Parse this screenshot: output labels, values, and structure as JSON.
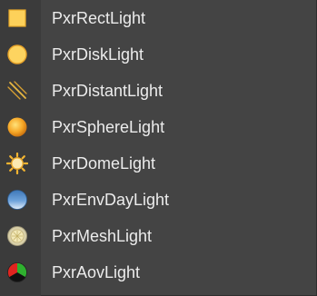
{
  "menu": {
    "items": [
      {
        "label": "PxrRectLight",
        "icon": "rect-light-icon"
      },
      {
        "label": "PxrDiskLight",
        "icon": "disk-light-icon"
      },
      {
        "label": "PxrDistantLight",
        "icon": "distant-light-icon"
      },
      {
        "label": "PxrSphereLight",
        "icon": "sphere-light-icon"
      },
      {
        "label": "PxrDomeLight",
        "icon": "dome-light-icon"
      },
      {
        "label": "PxrEnvDayLight",
        "icon": "env-day-light-icon"
      },
      {
        "label": "PxrMeshLight",
        "icon": "mesh-light-icon"
      },
      {
        "label": "PxrAovLight",
        "icon": "aov-light-icon"
      }
    ]
  },
  "colors": {
    "background": "#444444",
    "gutter": "#3b3b3b",
    "text": "#ececec",
    "light_yellow": "#fcc93c",
    "light_orange": "#f6a023",
    "sky_blue": "#5d93cf"
  }
}
